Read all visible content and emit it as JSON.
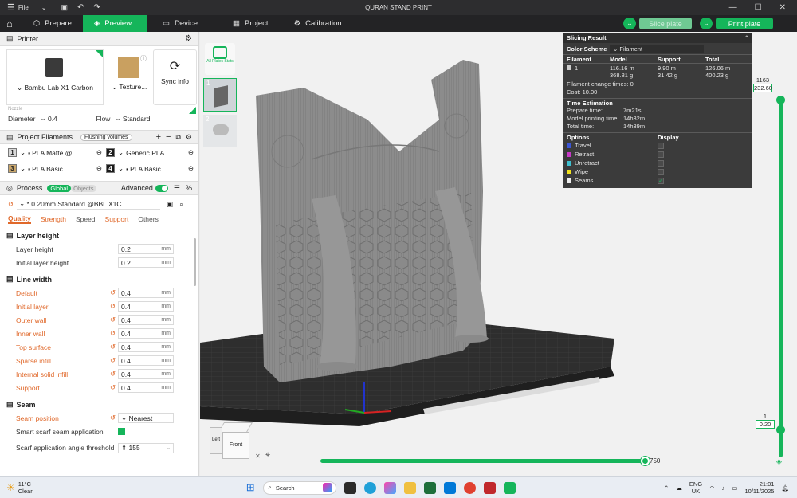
{
  "titlebar": {
    "menu_label": "File",
    "doc_title": "QURAN STAND PRINT"
  },
  "nav": {
    "tabs": [
      {
        "label": "Prepare",
        "icon": "cube-icon"
      },
      {
        "label": "Preview",
        "icon": "layers-icon"
      },
      {
        "label": "Device",
        "icon": "monitor-icon"
      },
      {
        "label": "Project",
        "icon": "grid-icon"
      },
      {
        "label": "Calibration",
        "icon": "gear-icon"
      }
    ],
    "slice_label": "Slice plate",
    "print_label": "Print plate"
  },
  "printer": {
    "header": "Printer",
    "name": "Bambu Lab X1 Carbon",
    "plate": "Texture...",
    "sync": "Sync info",
    "nozzle_label": "Nozzle",
    "diameter_label": "Diameter",
    "diameter_value": "0.4",
    "flow_label": "Flow",
    "flow_value": "Standard"
  },
  "filaments": {
    "header": "Project Filaments",
    "flushing": "Flushing volumes",
    "items": [
      {
        "num": "1",
        "name": "PLA Matte @...",
        "color": "#d8d8d8"
      },
      {
        "num": "2",
        "name": "Generic PLA",
        "color": "#1a1a1a"
      },
      {
        "num": "3",
        "name": "PLA Basic",
        "color": "#c9a66b"
      },
      {
        "num": "4",
        "name": "PLA Basic",
        "color": "#1a1a1a"
      }
    ]
  },
  "process": {
    "header": "Process",
    "global": "Global",
    "objects": "Objects",
    "advanced": "Advanced",
    "preset": "* 0.20mm Standard @BBL X1C",
    "tabs": [
      "Quality",
      "Strength",
      "Speed",
      "Support",
      "Others"
    ]
  },
  "layer_height": {
    "title": "Layer height",
    "rows": [
      {
        "label": "Layer height",
        "value": "0.2",
        "unit": "mm"
      },
      {
        "label": "Initial layer height",
        "value": "0.2",
        "unit": "mm"
      }
    ]
  },
  "line_width": {
    "title": "Line width",
    "rows": [
      {
        "label": "Default",
        "value": "0.4",
        "unit": "mm"
      },
      {
        "label": "Initial layer",
        "value": "0.4",
        "unit": "mm"
      },
      {
        "label": "Outer wall",
        "value": "0.4",
        "unit": "mm"
      },
      {
        "label": "Inner wall",
        "value": "0.4",
        "unit": "mm"
      },
      {
        "label": "Top surface",
        "value": "0.4",
        "unit": "mm"
      },
      {
        "label": "Sparse infill",
        "value": "0.4",
        "unit": "mm"
      },
      {
        "label": "Internal solid infill",
        "value": "0.4",
        "unit": "mm"
      },
      {
        "label": "Support",
        "value": "0.4",
        "unit": "mm"
      }
    ]
  },
  "seam": {
    "title": "Seam",
    "position_label": "Seam position",
    "position_value": "Nearest",
    "scarf_label": "Smart scarf seam application",
    "angle_label": "Scarf application angle threshold",
    "angle_value": "155"
  },
  "slicing": {
    "title": "Slicing Result",
    "scheme_label": "Color Scheme",
    "scheme_value": "Filament",
    "cols": [
      "Filament",
      "Model",
      "Support",
      "Total"
    ],
    "fil_id": "1",
    "model_m": "116.16 m",
    "model_g": "368.81 g",
    "support_m": "9.90 m",
    "support_g": "31.42 g",
    "total_m": "126.06 m",
    "total_g": "400.23 g",
    "change_times": "Filament change times:  0",
    "cost": "Cost:  10.00",
    "time_title": "Time Estimation",
    "times": [
      {
        "label": "Prepare time:",
        "value": "7m21s"
      },
      {
        "label": "Model printing time:",
        "value": "14h32m"
      },
      {
        "label": "Total time:",
        "value": "14h39m"
      }
    ],
    "options_label": "Options",
    "display_label": "Display",
    "options": [
      {
        "label": "Travel",
        "color": "#3b55d6",
        "checked": false
      },
      {
        "label": "Retract",
        "color": "#c838c8",
        "checked": false
      },
      {
        "label": "Unretract",
        "color": "#3ec0d0",
        "checked": false
      },
      {
        "label": "Wipe",
        "color": "#f2e21c",
        "checked": false
      },
      {
        "label": "Seams",
        "color": "#eeeeee",
        "checked": true
      }
    ]
  },
  "preview": {
    "plate_numbers": [
      "1",
      "2"
    ],
    "auto_plate": "All Plates Stats",
    "layer_top": "1163",
    "height_top": "232.60",
    "layer_bottom": "1",
    "height_bottom": "0.20",
    "move_value": "750",
    "cube_left": "Left",
    "cube_front": "Front"
  },
  "taskbar": {
    "weather_temp": "11°C",
    "weather_desc": "Clear",
    "search": "Search",
    "lang": "ENG",
    "region": "UK",
    "time": "21:01",
    "date": "10/11/2025"
  }
}
